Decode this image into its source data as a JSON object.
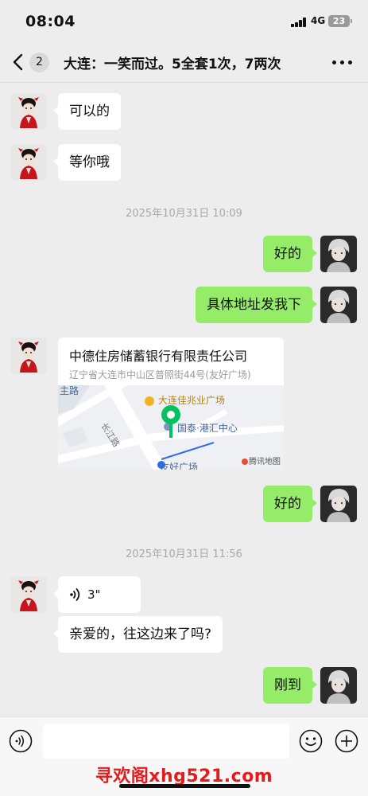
{
  "status": {
    "time": "08:04",
    "network": "4G",
    "battery": "23"
  },
  "nav": {
    "unread_count": "2",
    "title": "大连：一笑而过。5全套1次，7两次"
  },
  "messages": [
    {
      "side": "left",
      "text": "可以的"
    },
    {
      "side": "left",
      "text": "等你哦"
    },
    {
      "type": "time",
      "text": "2025年10月31日 10:09"
    },
    {
      "side": "right",
      "text": "好的"
    },
    {
      "side": "right",
      "text": "具体地址发我下"
    },
    {
      "side": "left",
      "type": "location",
      "name": "中德住房储蓄银行有限责任公司",
      "address": "辽宁省大连市中山区普照街44号(友好广场)",
      "map": {
        "poi1": "大连佳兆业广场",
        "poi2": "国泰·港汇中心",
        "road": "长江路",
        "plaza": "友好广场",
        "corner": "主路",
        "brand": "腾讯地图"
      }
    },
    {
      "side": "right",
      "text": "好的"
    },
    {
      "type": "time",
      "text": "2025年10月31日 11:56"
    },
    {
      "side": "left",
      "type": "voice",
      "duration": "3\""
    },
    {
      "side": "left",
      "text": "亲爱的，往这边来了吗?"
    },
    {
      "side": "right",
      "text": "刚到"
    }
  ],
  "watermark": "寻欢阁xhg521.com",
  "colors": {
    "bubble_green": "#95ec69",
    "background": "#ededed",
    "watermark_red": "#e61a1a",
    "map_pin": "#07c160"
  },
  "icons": [
    "back-icon",
    "more-icon",
    "voice-wave-icon",
    "voice-mode-icon",
    "emoji-icon",
    "plus-icon"
  ]
}
